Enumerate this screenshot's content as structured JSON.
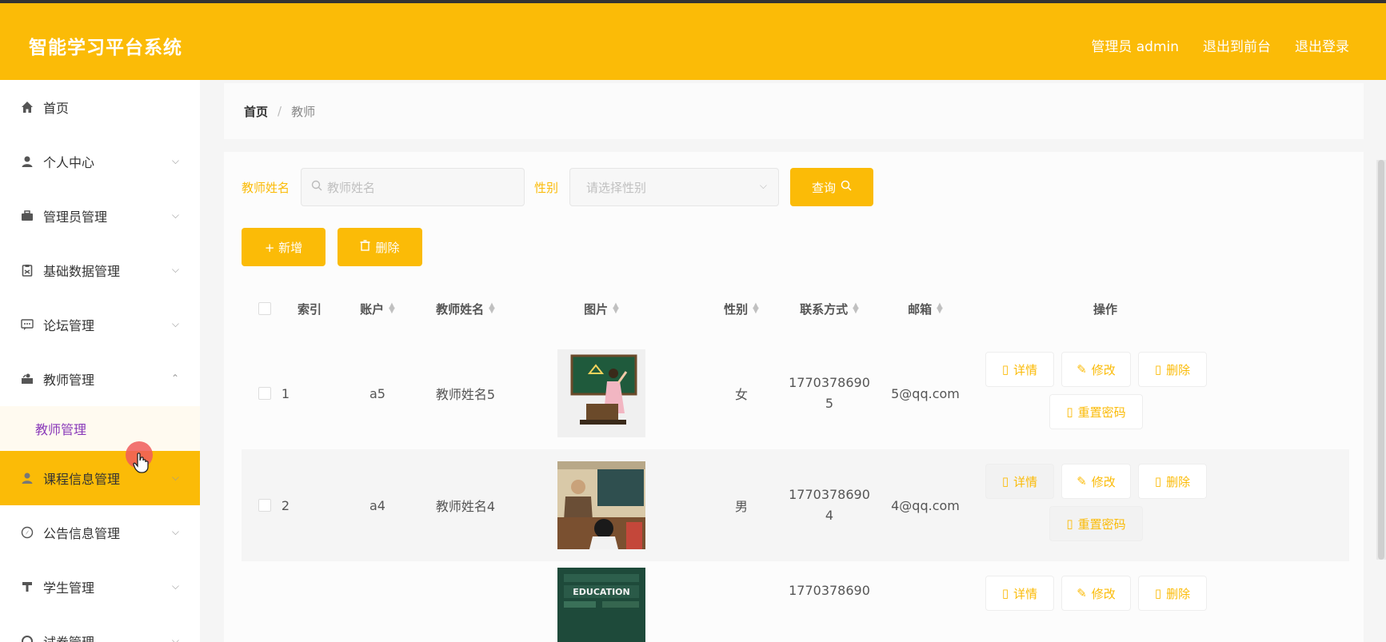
{
  "header": {
    "app_title": "智能学习平台系统",
    "user_label": "管理员 admin",
    "front_label": "退出到前台",
    "logout_label": "退出登录"
  },
  "sidebar": {
    "items": [
      {
        "label": "首页",
        "icon": "home-icon"
      },
      {
        "label": "个人中心",
        "icon": "user-icon"
      },
      {
        "label": "管理员管理",
        "icon": "briefcase-icon"
      },
      {
        "label": "基础数据管理",
        "icon": "clipboard-icon"
      },
      {
        "label": "论坛管理",
        "icon": "chat-icon"
      },
      {
        "label": "教师管理",
        "icon": "teacher-icon"
      },
      {
        "label": "课程信息管理",
        "icon": "user-icon"
      },
      {
        "label": "公告信息管理",
        "icon": "compass-icon"
      },
      {
        "label": "学生管理",
        "icon": "podium-icon"
      },
      {
        "label": "试卷管理",
        "icon": "settings-icon"
      }
    ],
    "submenu_teacher": "教师管理"
  },
  "breadcrumb": {
    "home": "首页",
    "separator": "/",
    "current": "教师"
  },
  "search": {
    "name_label": "教师姓名",
    "name_placeholder": "教师姓名",
    "gender_label": "性别",
    "gender_placeholder": "请选择性别",
    "query_label": "查询"
  },
  "actions": {
    "add_label": "+ 新增",
    "delete_label": "删除"
  },
  "table": {
    "headers": {
      "index": "索引",
      "account": "账户",
      "name": "教师姓名",
      "photo": "图片",
      "gender": "性别",
      "phone": "联系方式",
      "email": "邮箱",
      "ops": "操作"
    },
    "row_ops": {
      "detail": "详情",
      "edit": "修改",
      "delete": "删除",
      "reset": "重置密码"
    },
    "rows": [
      {
        "index": "1",
        "account": "a5",
        "name": "教师姓名5",
        "gender": "女",
        "phone_line1": "1770378690",
        "phone_line2": "5",
        "email": "5@qq.com",
        "photo": "teacher-at-blackboard"
      },
      {
        "index": "2",
        "account": "a4",
        "name": "教师姓名4",
        "gender": "男",
        "phone_line1": "1770378690",
        "phone_line2": "4",
        "email": "4@qq.com",
        "photo": "classroom-teacher"
      },
      {
        "index": "",
        "account": "",
        "name": "",
        "gender": "",
        "phone_line1": "1770378690",
        "phone_line2": "",
        "email": "",
        "photo": "education-board",
        "photo_text": "EDUCATION"
      }
    ]
  },
  "colors": {
    "accent": "#fbbb07",
    "submenu_text": "#8a3ab9"
  }
}
